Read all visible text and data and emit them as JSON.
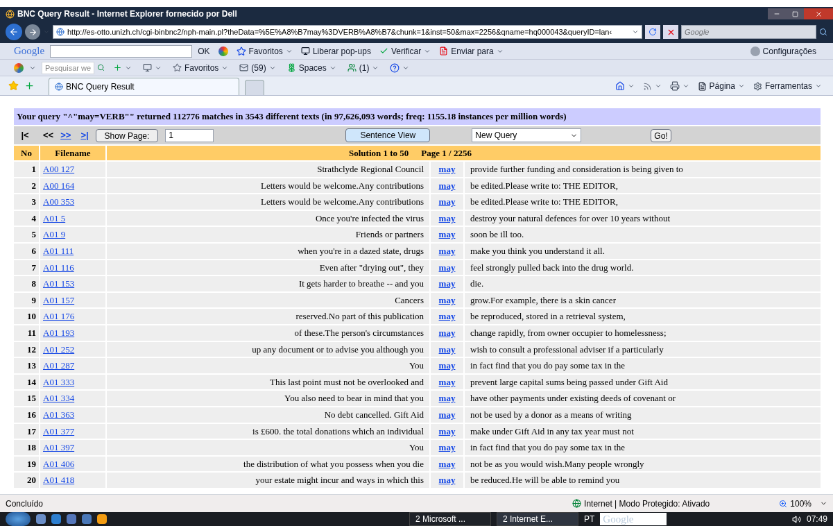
{
  "window": {
    "title": "BNC Query Result - Internet Explorer fornecido por Dell"
  },
  "address_bar": {
    "url": "http://es-otto.unizh.ch/cgi-binbnc2/nph-main.pl?theData=%5E%A8%B7may%3DVERB%A8%B7&chunk=1&inst=50&max=2256&qname=hq000043&queryID=lan‹",
    "search_placeholder": "Google"
  },
  "google_toolbar": {
    "logo": "Google",
    "ok": "OK",
    "favorites": "Favoritos",
    "popups": "Liberar pop-ups",
    "check": "Verificar",
    "send": "Enviar para",
    "settings": "Configurações"
  },
  "second_toolbar": {
    "search_placeholder": "Pesquisar we",
    "favorites": "Favoritos",
    "mail_count": "(59)",
    "spaces": "Spaces",
    "contacts": "(1)"
  },
  "tabs": [
    {
      "label": "BNC Query Result",
      "selected": true
    }
  ],
  "command_bar": {
    "page": "Página",
    "tools": "Ferramentas"
  },
  "query_summary": "Your query \"^\"may=VERB\"\" returned 112776 matches in 3543 different texts (in 97,626,093 words; freq: 1155.18 instances per million words)",
  "nav": {
    "first": "|<",
    "prev": "<<",
    "next": ">>",
    "last": ">|",
    "show_page": "Show Page:",
    "page_value": "1",
    "sentence_view": "Sentence View",
    "query_select": "New Query",
    "go": "Go!"
  },
  "table": {
    "columns": [
      "No",
      "Filename",
      "Solution 1 to 50",
      "Page 1 / 2256"
    ],
    "rows": [
      {
        "no": "1",
        "file": "A00 127",
        "left": "Strathclyde Regional Council",
        "match": "may",
        "right": "provide further funding and consideration is being given to"
      },
      {
        "no": "2",
        "file": "A00 164",
        "left": "Letters would be welcome.Any contributions",
        "match": "may",
        "right": "be edited.Please write to: THE EDITOR,"
      },
      {
        "no": "3",
        "file": "A00 353",
        "left": "Letters would be welcome.Any contributions",
        "match": "may",
        "right": "be edited.Please write to: THE EDITOR,"
      },
      {
        "no": "4",
        "file": "A01 5",
        "left": "Once you're infected the virus",
        "match": "may",
        "right": "destroy your natural defences for over 10 years without"
      },
      {
        "no": "5",
        "file": "A01 9",
        "left": "Friends or partners",
        "match": "may",
        "right": "soon be ill too."
      },
      {
        "no": "6",
        "file": "A01 111",
        "left": "when you're in a dazed state, drugs",
        "match": "may",
        "right": "make you think you understand it all."
      },
      {
        "no": "7",
        "file": "A01 116",
        "left": "Even after \"drying out\", they",
        "match": "may",
        "right": "feel strongly pulled back into the drug world."
      },
      {
        "no": "8",
        "file": "A01 153",
        "left": "It gets harder to breathe -- and you",
        "match": "may",
        "right": "die."
      },
      {
        "no": "9",
        "file": "A01 157",
        "left": "Cancers",
        "match": "may",
        "right": "grow.For example, there is a skin cancer"
      },
      {
        "no": "10",
        "file": "A01 176",
        "left": "reserved.No part of this publication",
        "match": "may",
        "right": "be reproduced, stored in a retrieval system,"
      },
      {
        "no": "11",
        "file": "A01 193",
        "left": "of these.The person's circumstances",
        "match": "may",
        "right": "change rapidly, from owner occupier to homelessness;"
      },
      {
        "no": "12",
        "file": "A01 252",
        "left": "up any document or to advise you although you",
        "match": "may",
        "right": "wish to consult a professional adviser if a particularly"
      },
      {
        "no": "13",
        "file": "A01 287",
        "left": "You",
        "match": "may",
        "right": "in fact find that you do pay some tax in the"
      },
      {
        "no": "14",
        "file": "A01 333",
        "left": "This last point must not be overlooked and",
        "match": "may",
        "right": "prevent large capital sums being passed under Gift Aid"
      },
      {
        "no": "15",
        "file": "A01 334",
        "left": "You also need to bear in mind that you",
        "match": "may",
        "right": "have other payments under existing deeds of covenant or"
      },
      {
        "no": "16",
        "file": "A01 363",
        "left": "No debt cancelled. Gift Aid",
        "match": "may",
        "right": "not be used by a donor as a means of writing"
      },
      {
        "no": "17",
        "file": "A01 377",
        "left": "is £600. the total donations which an individual",
        "match": "may",
        "right": "make under Gift Aid in any tax year must not"
      },
      {
        "no": "18",
        "file": "A01 397",
        "left": "You",
        "match": "may",
        "right": "in fact find that you do pay some tax in the"
      },
      {
        "no": "19",
        "file": "A01 406",
        "left": "the distribution of what you possess when you die",
        "match": "may",
        "right": "not be as you would wish.Many people wrongly"
      },
      {
        "no": "20",
        "file": "A01 418",
        "left": "your estate might incur and ways in which this",
        "match": "may",
        "right": "be reduced.He will be able to remind you"
      }
    ]
  },
  "status_bar": {
    "text": "Concluído",
    "zone": "Internet | Modo Protegido: Ativado",
    "zoom": "100%"
  },
  "taskbar": {
    "buttons": [
      {
        "label": "2 Microsoft ...",
        "selected": false
      },
      {
        "label": "2 Internet E...",
        "selected": true
      }
    ],
    "language": "PT",
    "search": "Google",
    "clock": "07:49"
  }
}
